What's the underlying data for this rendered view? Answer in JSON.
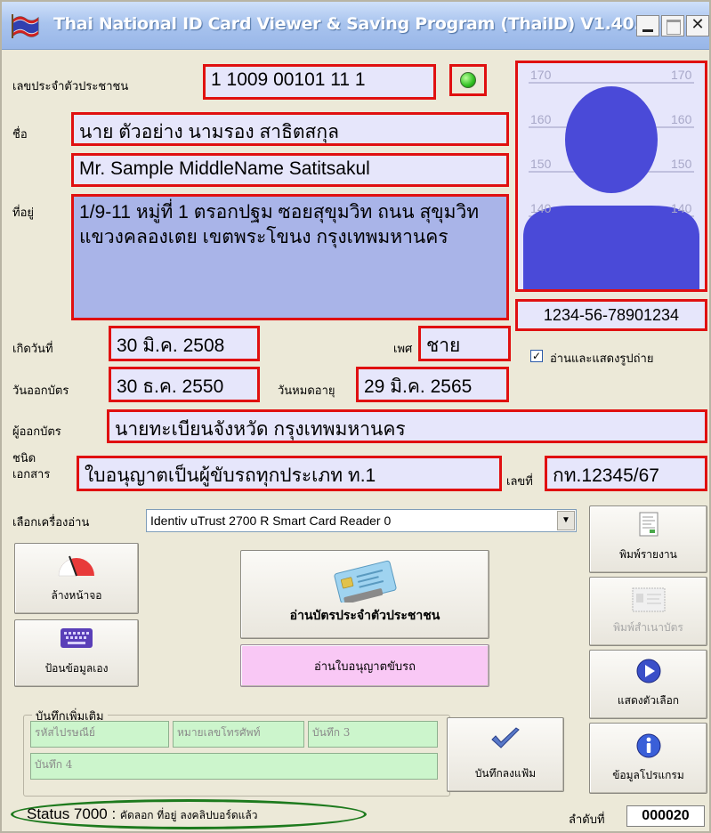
{
  "window": {
    "title": "Thai National ID Card Viewer & Saving Program (ThaiID) V1.40.0"
  },
  "card": {
    "id_label": "เลขประจำตัวประชาชน",
    "id_value": "1 1009 00101 11 1",
    "name_label": "ชื่อ",
    "name_th": "นาย ตัวอย่าง นามรอง สาธิตสกุล",
    "name_en": "Mr. Sample MiddleName Satitsakul",
    "address_label": "ที่อยู่",
    "address": "1/9-11 หมู่ที่ 1 ตรอกปฐม ซอยสุขุมวิท ถนน สุขุมวิท แขวงคลองเตย เขตพระโขนง กรุงเทพมหานคร",
    "birth_label": "เกิดวันที่",
    "birth_value": "30 มิ.ค. 2508",
    "sex_label": "เพศ",
    "sex_value": "ชาย",
    "issue_label": "วันออกบัตร",
    "issue_value": "30 ธ.ค. 2550",
    "expire_label": "วันหมดอายุ",
    "expire_value": "29 มิ.ค. 2565",
    "issuer_label": "ผู้ออกบัตร",
    "issuer_value": "นายทะเบียนจังหวัด กรุงเทพมหานคร",
    "doctype_label_1": "ชนิด",
    "doctype_label_2": "เอกสาร",
    "doctype_value": "ใบอนุญาตเป็นผู้ขับรถทุกประเภท ท.1",
    "docno_label": "เลขที่",
    "docno_value": "กท.12345/67"
  },
  "photo": {
    "height_marks_left": [
      "170",
      "160",
      "150",
      "140"
    ],
    "height_marks_right": [
      "170",
      "160",
      "150",
      "140"
    ],
    "photo_number": "1234-56-78901234",
    "show_photo_label": "อ่านและแสดงรูปถ่าย",
    "show_photo_checked": true
  },
  "reader": {
    "label": "เลือกเครื่องอ่าน",
    "selected": "Identiv uTrust 2700 R Smart Card Reader 0"
  },
  "buttons": {
    "clear": "ล้างหน้าจอ",
    "manual": "ป้อนข้อมูลเอง",
    "read_id": "อ่านบัตรประจำตัวประชาชน",
    "read_license": "อ่านใบอนุญาตขับรถ",
    "print_report": "พิมพ์รายงาน",
    "print_copy": "พิมพ์สำเนาบัตร",
    "options": "แสดงตัวเลือก",
    "about": "ข้อมูลโปรแกรม",
    "save_extra": "บันทึกลงแฟ้ม"
  },
  "notes": {
    "group_title": "บันทึกเพิ่มเติม",
    "postal": "รหัสไปรษณีย์",
    "phone": "หมายเลขโทรศัพท์",
    "note3": "บันทึก 3",
    "note4": "บันทึก 4"
  },
  "status": {
    "code": "Status 7000 :",
    "message": "คัดลอก ที่อยู่ ลงคลิปบอร์ดแล้ว",
    "order_label": "ลำดับที่",
    "order_value": "000020"
  },
  "colors": {
    "highlight_border": "#e01010",
    "status_ellipse": "#1d7a1d",
    "field_bg": "#e6e6fb",
    "address_bg": "#a9b4e8",
    "notes_bg": "#ccf5cc",
    "license_button_bg": "#f9c8f5",
    "silhouette": "#4a4ad8"
  }
}
